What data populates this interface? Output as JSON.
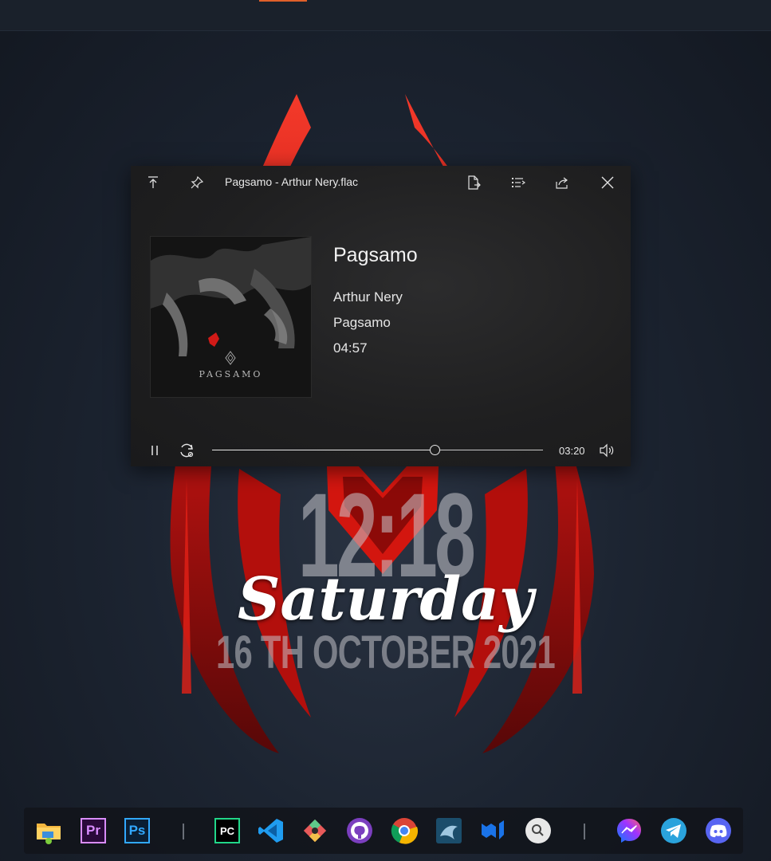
{
  "player": {
    "window_title": "Pagsamo - Arthur Nery.flac",
    "song_title": "Pagsamo",
    "artist": "Arthur Nery",
    "album": "Pagsamo",
    "duration": "04:57",
    "position": "03:20",
    "progress_fraction": 0.6734,
    "cover_text": "PAGSAMO",
    "titlebar_icons": [
      "arrow-up-to-top-icon",
      "pin-icon",
      "file-export-icon",
      "playlist-icon",
      "share-icon",
      "close-icon"
    ],
    "control_icons": [
      "pause-icon",
      "repeat-icon",
      "volume-icon"
    ]
  },
  "desktop": {
    "clock_time": "12:18",
    "clock_day": "Saturday",
    "clock_date": "16 TH OCTOBER 2021",
    "accent_color": "#e0602a",
    "emblem_color": "#c8120f"
  },
  "taskbar": {
    "apps_left": [
      {
        "name": "file-explorer-icon"
      },
      {
        "name": "premiere-pro-icon",
        "label": "Pr",
        "color": "#d98cff",
        "bg": "#2a0a3a"
      },
      {
        "name": "photoshop-icon",
        "label": "Ps",
        "color": "#31a8ff",
        "bg": "#0a1e33"
      }
    ],
    "apps_middle": [
      {
        "name": "pycharm-icon",
        "label": "PC"
      },
      {
        "name": "vscode-icon"
      },
      {
        "name": "gitkraken-icon"
      },
      {
        "name": "github-icon"
      },
      {
        "name": "chrome-icon"
      },
      {
        "name": "mysql-workbench-icon"
      },
      {
        "name": "material-ui-icon"
      },
      {
        "name": "search-icon"
      }
    ],
    "apps_right": [
      {
        "name": "messenger-icon"
      },
      {
        "name": "telegram-icon"
      },
      {
        "name": "discord-icon"
      }
    ]
  }
}
